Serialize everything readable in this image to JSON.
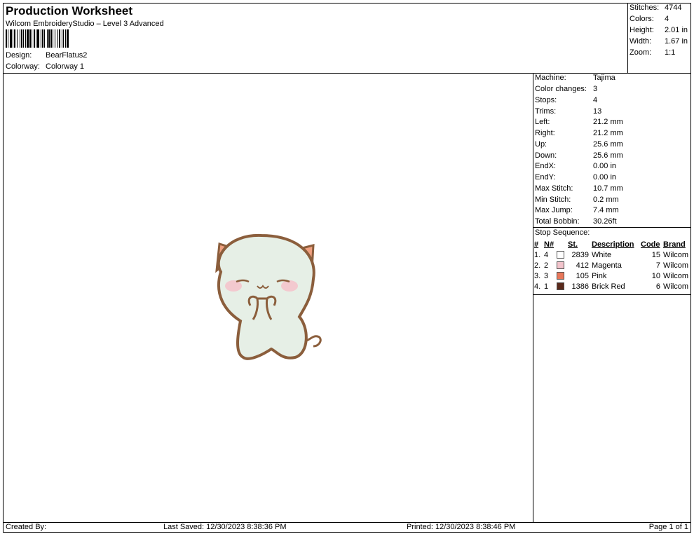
{
  "header": {
    "title": "Production Worksheet",
    "subtitle": "Wilcom EmbroideryStudio – Level 3 Advanced",
    "design_label": "Design:",
    "design_value": "BearFlatus2",
    "colorway_label": "Colorway:",
    "colorway_value": "Colorway 1"
  },
  "summary": [
    {
      "label": "Stitches:",
      "value": "4744"
    },
    {
      "label": "Colors:",
      "value": "4"
    },
    {
      "label": "Height:",
      "value": "2.01 in"
    },
    {
      "label": "Width:",
      "value": "1.67 in"
    },
    {
      "label": "Zoom:",
      "value": "1:1"
    }
  ],
  "details": [
    {
      "label": "Machine:",
      "value": "Tajima"
    },
    {
      "label": "Color changes:",
      "value": "3"
    },
    {
      "label": "Stops:",
      "value": "4"
    },
    {
      "label": "Trims:",
      "value": "13"
    },
    {
      "label": "Left:",
      "value": "21.2 mm"
    },
    {
      "label": "Right:",
      "value": "21.2 mm"
    },
    {
      "label": "Up:",
      "value": "25.6 mm"
    },
    {
      "label": "Down:",
      "value": "25.6 mm"
    },
    {
      "label": "EndX:",
      "value": "0.00 in"
    },
    {
      "label": "EndY:",
      "value": "0.00 in"
    },
    {
      "label": "Max Stitch:",
      "value": "10.7 mm"
    },
    {
      "label": "Min Stitch:",
      "value": "0.2 mm"
    },
    {
      "label": "Max Jump:",
      "value": "7.4 mm"
    },
    {
      "label": "Total Bobbin:",
      "value": "30.26ft"
    }
  ],
  "stop_sequence": {
    "label": "Stop Sequence:",
    "headers": [
      "#",
      "N#",
      "St.",
      "Description",
      "Code",
      "Brand"
    ],
    "rows": [
      {
        "num": "1.",
        "n": "4",
        "color": "#ffffff",
        "st": "2839",
        "desc": "White",
        "code": "15",
        "brand": "Wilcom"
      },
      {
        "num": "2.",
        "n": "2",
        "color": "#f2c4cc",
        "st": "412",
        "desc": "Magenta",
        "code": "7",
        "brand": "Wilcom"
      },
      {
        "num": "3.",
        "n": "3",
        "color": "#e8775a",
        "st": "105",
        "desc": "Pink",
        "code": "10",
        "brand": "Wilcom"
      },
      {
        "num": "4.",
        "n": "1",
        "color": "#5a2a1c",
        "st": "1386",
        "desc": "Brick Red",
        "code": "6",
        "brand": "Wilcom"
      }
    ]
  },
  "footer": {
    "created_by": "Created By:",
    "last_saved": "Last Saved: 12/30/2023 8:38:36 PM",
    "printed": "Printed: 12/30/2023 8:38:46 PM",
    "page": "Page 1 of 1"
  },
  "colors": {
    "body_fill": "#e6efe6",
    "outline": "#8b5e3c",
    "ear_inner": "#f0a080",
    "cheek": "#f3c9cf"
  }
}
